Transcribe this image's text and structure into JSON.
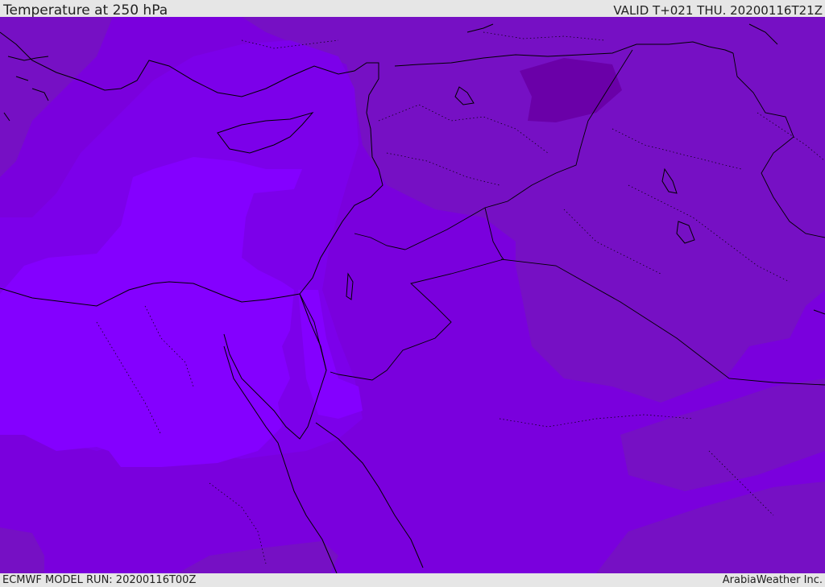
{
  "header": {
    "title": "Temperature at 250 hPa",
    "valid": "VALID T+021 THU. 20200116T21Z"
  },
  "footer": {
    "model_run": "ECMWF MODEL RUN: 20200116T00Z",
    "credit": "ArabiaWeather Inc."
  },
  "colors": {
    "bar_background": "#e6e6e6",
    "band_warmest": "#8400ff",
    "band_warm": "#7c00ea",
    "band_mid": "#7a00dd",
    "band_cool": "#7610c4",
    "band_coldest": "#6a00a8",
    "coastline": "#000000"
  },
  "map_features": [
    "temperature-shading",
    "coastlines",
    "country-borders",
    "province-boundaries"
  ]
}
